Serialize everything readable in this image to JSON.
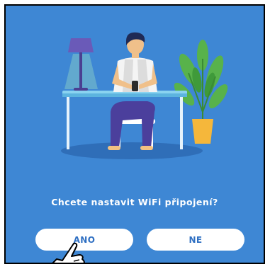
{
  "dialog": {
    "question": "Chcete nastavit WiFi připojení?",
    "yes_label": "ANO",
    "no_label": "NE"
  },
  "colors": {
    "background": "#3e87d4",
    "button": "#ffffff",
    "button_text": "#2e6fc2"
  },
  "icons": {
    "illustration": "person-at-desk-illustration",
    "pointer": "pointing-hand-icon"
  }
}
